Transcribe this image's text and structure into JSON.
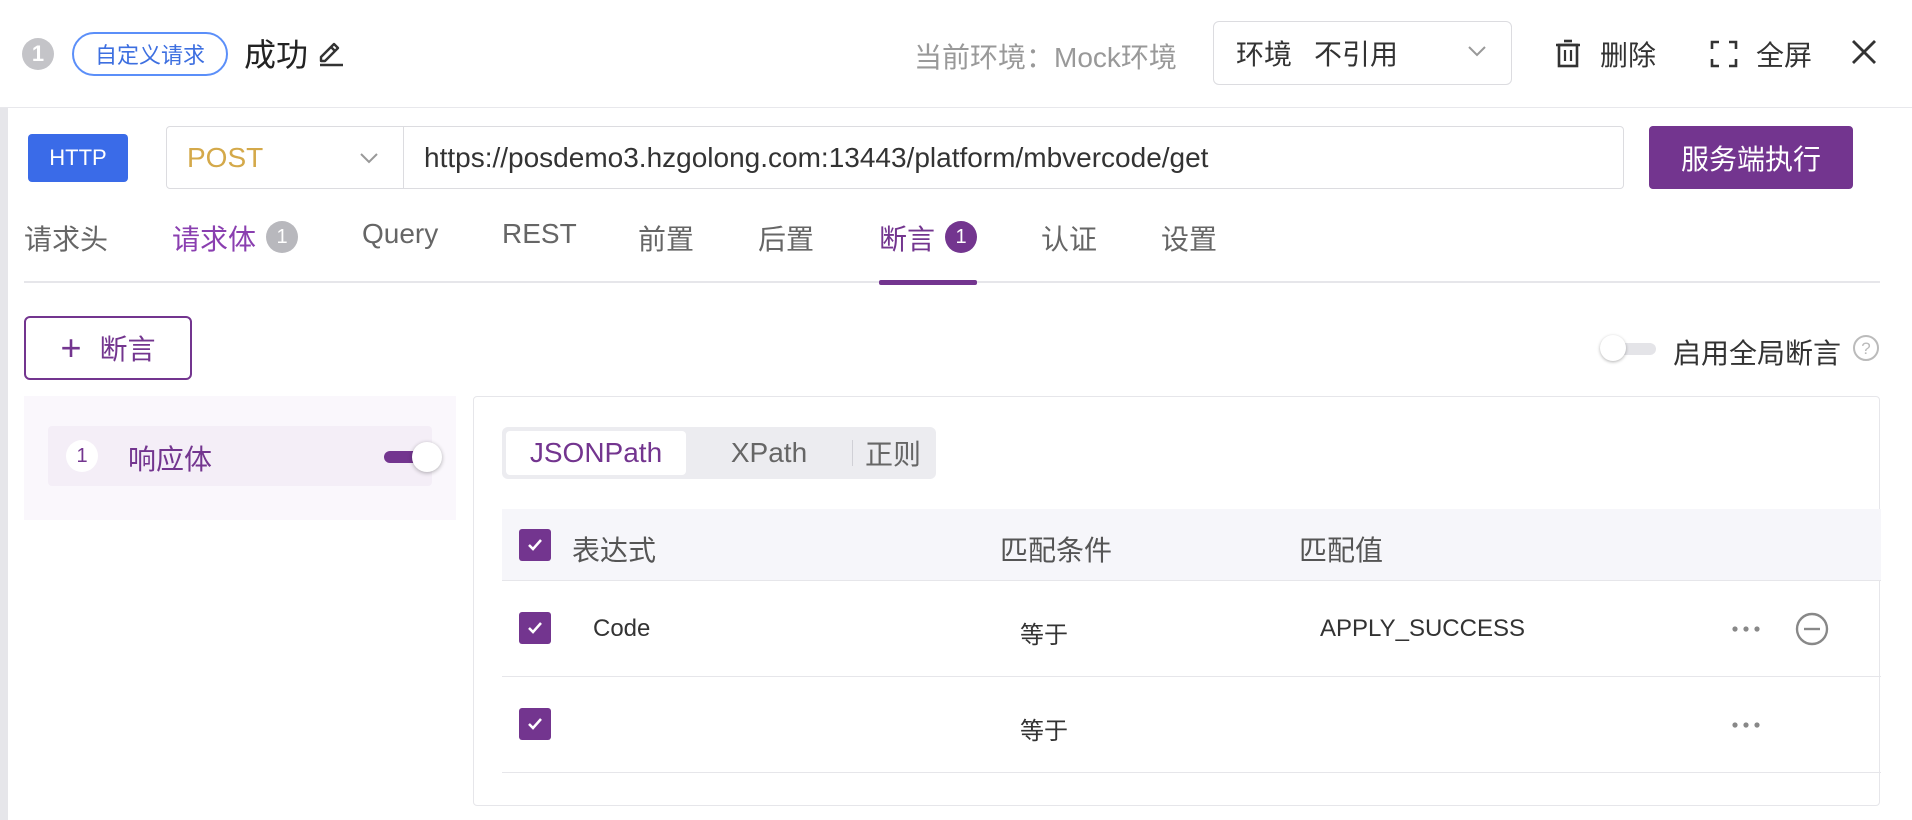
{
  "header": {
    "step_number": "1",
    "request_tag": "自定义请求",
    "title": "成功",
    "env_text": "当前环境：Mock环境",
    "env_select_label": "环境",
    "env_select_value": "不引用",
    "delete_label": "删除",
    "fullscreen_label": "全屏"
  },
  "request": {
    "protocol": "HTTP",
    "method": "POST",
    "url": "https://posdemo3.hzgolong.com:13443/platform/mbvercode/get",
    "execute_label": "服务端执行"
  },
  "tabs": [
    {
      "label": "请求头",
      "badge": ""
    },
    {
      "label": "请求体",
      "badge": "1"
    },
    {
      "label": "Query",
      "badge": ""
    },
    {
      "label": "REST",
      "badge": ""
    },
    {
      "label": "前置",
      "badge": ""
    },
    {
      "label": "后置",
      "badge": ""
    },
    {
      "label": "断言",
      "badge": "1"
    },
    {
      "label": "认证",
      "badge": ""
    },
    {
      "label": "设置",
      "badge": ""
    }
  ],
  "assertion": {
    "add_label": "断言",
    "global_label": "启用全局断言",
    "global_enabled": false,
    "items": [
      {
        "index": "1",
        "label": "响应体",
        "enabled": true
      }
    ],
    "modes": [
      "JSONPath",
      "XPath",
      "正则"
    ],
    "active_mode": "JSONPath",
    "table": {
      "headers": [
        "表达式",
        "匹配条件",
        "匹配值"
      ],
      "rows": [
        {
          "checked": true,
          "expression": "Code",
          "condition": "等于",
          "value": "APPLY_SUCCESS"
        },
        {
          "checked": true,
          "expression": "",
          "condition": "等于",
          "value": ""
        }
      ]
    }
  },
  "colors": {
    "brand_purple": "#73358f",
    "http_blue": "#3a6be8",
    "method_gold": "#d4a94a"
  }
}
